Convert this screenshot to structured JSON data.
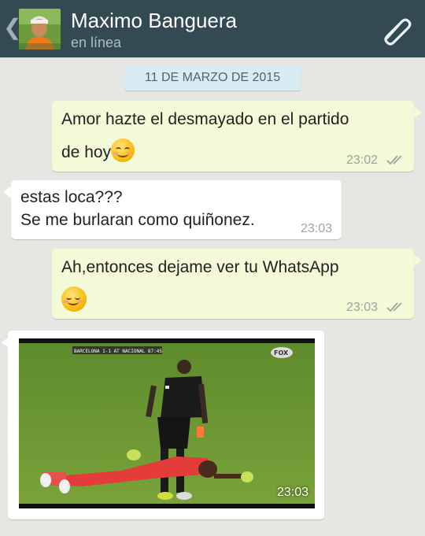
{
  "header": {
    "back_glyph": "❮",
    "contact_name": "Maximo Banguera",
    "status": "en línea",
    "bg_color": "#344a52"
  },
  "chat": {
    "date_chip": "11 DE MARZO DE 2015",
    "messages": [
      {
        "direction": "out",
        "text_line1": "Amor hazte el desmayado en el partido",
        "text_line2": "de hoy",
        "emoji": "smiling-face-icon",
        "time": "23:02",
        "read": true
      },
      {
        "direction": "in",
        "text_line1": "estas loca???",
        "text_line2": "Se me burlaran como quiñonez.",
        "time": "23:03"
      },
      {
        "direction": "out",
        "text_line1": "Ah,entonces dejame ver tu WhatsApp",
        "emoji": "relieved-face-icon",
        "time": "23:03",
        "read": true
      },
      {
        "direction": "in",
        "type": "image",
        "scoreboard": "BARCELONA 1-1 AT NACIONAL 87:45",
        "channel_logo": "FOX",
        "time": "23:03"
      }
    ],
    "outgoing_color": "#f2fad8",
    "incoming_color": "#ffffff",
    "background_color": "#e6e6e3"
  }
}
